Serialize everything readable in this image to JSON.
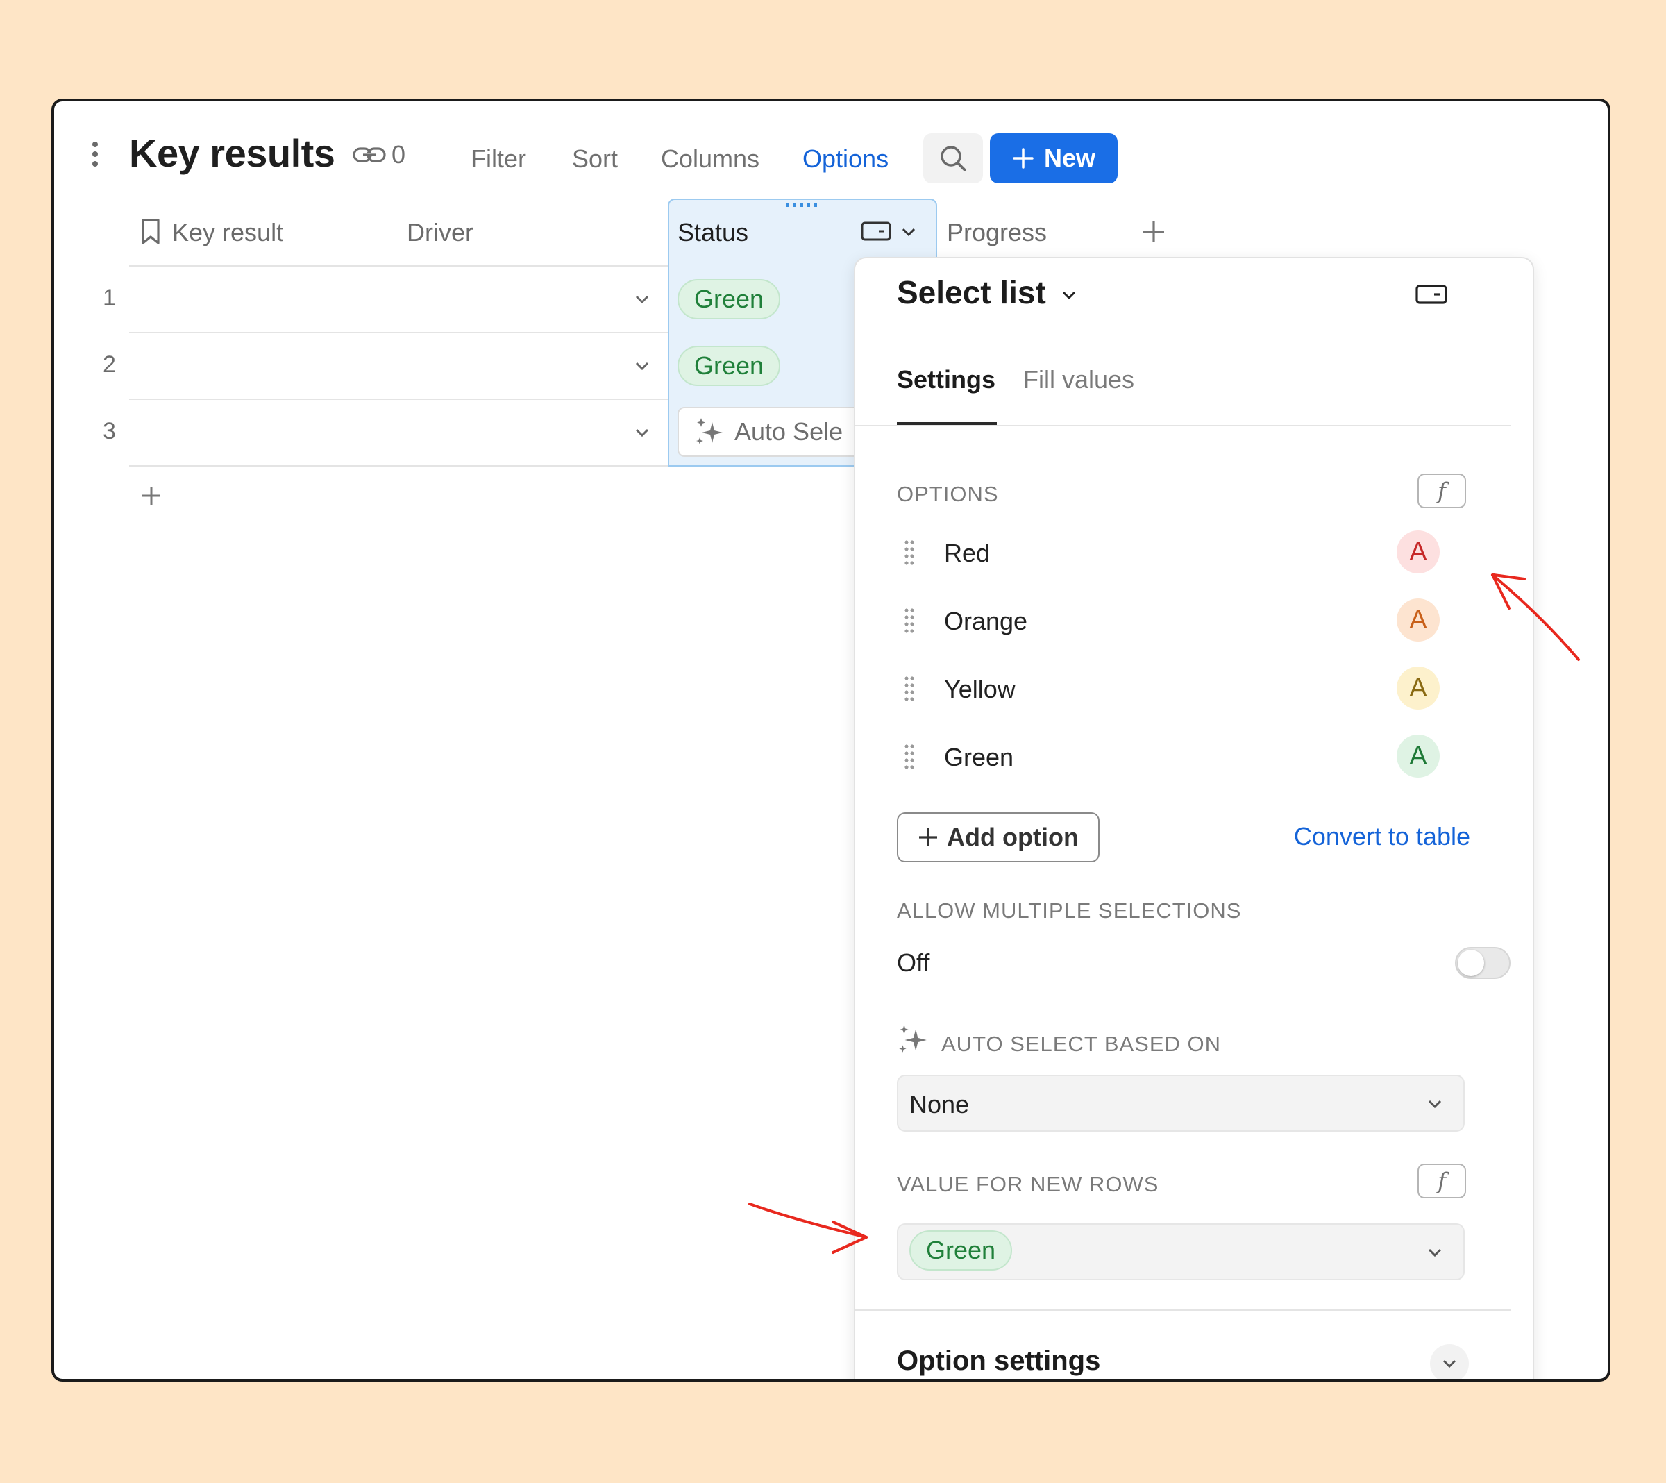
{
  "header": {
    "title": "Key results",
    "link_count": "0",
    "toolbar": {
      "filter": "Filter",
      "sort": "Sort",
      "columns": "Columns",
      "options": "Options"
    },
    "new_label": "New"
  },
  "table": {
    "columns": {
      "key_result": "Key result",
      "driver": "Driver",
      "status": "Status",
      "progress": "Progress"
    },
    "rows": [
      {
        "num": "1",
        "status": "Green"
      },
      {
        "num": "2",
        "status": "Green"
      },
      {
        "num": "3",
        "status": "Auto Sele"
      }
    ]
  },
  "panel": {
    "title": "Select list",
    "tabs": {
      "settings": "Settings",
      "fill_values": "Fill values"
    },
    "options_label": "OPTIONS",
    "options": [
      {
        "label": "Red",
        "letter": "A",
        "bg": "#fde0e0",
        "fg": "#c62828"
      },
      {
        "label": "Orange",
        "letter": "A",
        "bg": "#fde4d0",
        "fg": "#c8601a"
      },
      {
        "label": "Yellow",
        "letter": "A",
        "bg": "#fdf1cc",
        "fg": "#8a6a12"
      },
      {
        "label": "Green",
        "letter": "A",
        "bg": "#dff3e4",
        "fg": "#1f7a37"
      }
    ],
    "add_option": "Add option",
    "convert_to_table": "Convert to table",
    "allow_multiple_label": "ALLOW MULTIPLE SELECTIONS",
    "allow_multiple_value": "Off",
    "auto_select_label": "AUTO SELECT BASED ON",
    "auto_select_value": "None",
    "value_new_rows_label": "VALUE FOR NEW ROWS",
    "value_new_rows": "Green",
    "option_settings": "Option settings"
  },
  "colors": {
    "accent": "#1a6ee6",
    "annotation": "#e8281e",
    "background": "#fee5c6"
  }
}
